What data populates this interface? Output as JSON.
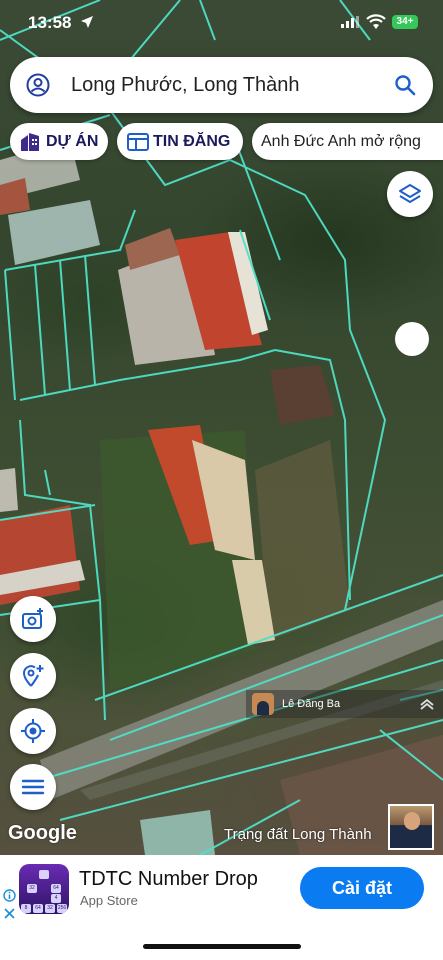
{
  "status_bar": {
    "time": "13:58",
    "battery": "34+"
  },
  "search": {
    "query": "Long Phước, Long Thành",
    "icons": [
      "user-icon",
      "search-icon"
    ]
  },
  "chips": {
    "du_an": "DỰ ÁN",
    "tin_dang": "TIN ĐĂNG",
    "anh_duc": "Anh Đức Anh mở rộng"
  },
  "map": {
    "owner_tag": "Lê Đăng Ba",
    "google_label": "Google",
    "caption": "Trạng đất Long Thành",
    "colors": {
      "parcel_lines": "#4fe0c8",
      "accent": "#3f2a8c"
    }
  },
  "ad": {
    "app_title": "TDTC Number Drop",
    "app_store": "App Store",
    "install_label": "Cài đặt",
    "colors": {
      "install_button": "#0a7bf0"
    }
  }
}
